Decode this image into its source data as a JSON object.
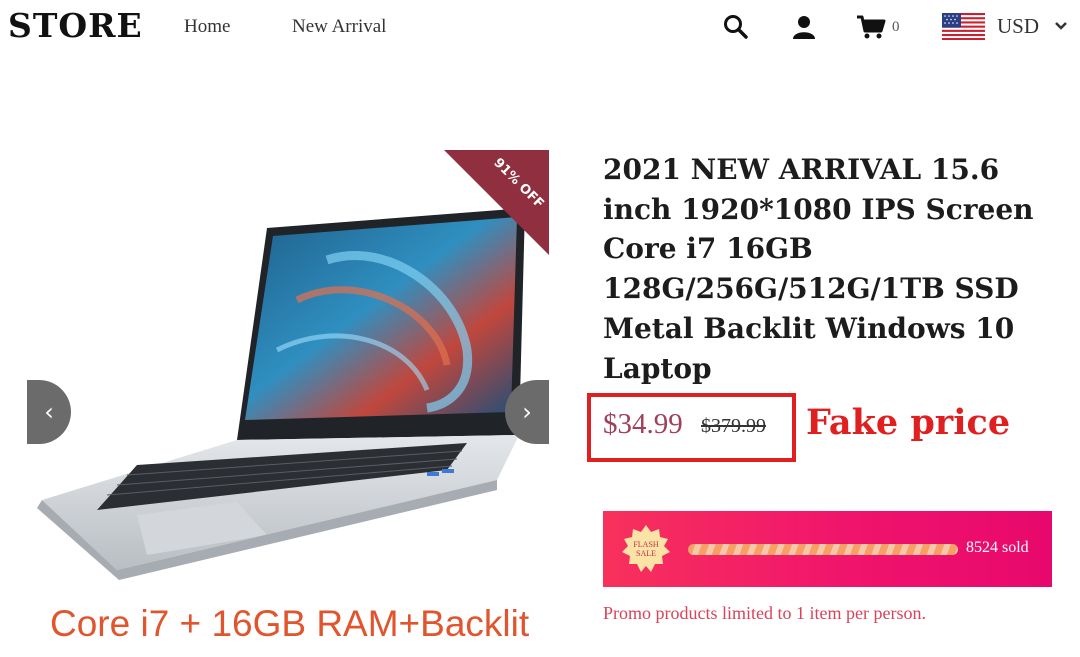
{
  "header": {
    "logo": "STORE",
    "nav": [
      "Home",
      "New Arrival"
    ],
    "cart_count": "0",
    "currency": "USD",
    "icons": [
      "search-icon",
      "user-icon",
      "cart-icon",
      "us-flag-icon",
      "chevron-down-icon"
    ]
  },
  "gallery": {
    "discount_ribbon": "91% OFF",
    "prev_symbol": "‹",
    "next_symbol": "›",
    "caption": "Core i7 + 16GB RAM+Backlit"
  },
  "product": {
    "title": "2021 NEW ARRIVAL 15.6 inch 1920*1080 IPS Screen Core i7 16GB 128G/256G/512G/1TB SSD Metal Backlit Windows 10 Laptop",
    "price": "$34.99",
    "compare_price": "$379.99",
    "annotation": "Fake price"
  },
  "flash_sale": {
    "badge_lines": [
      "FLASH",
      "SALE"
    ],
    "sold_text": "8524 sold",
    "promo_note": "Promo products limited to 1 item per person."
  },
  "colors": {
    "annotation_red": "#e02020",
    "price": "#a0405a",
    "flash_bg": "#f0146c",
    "ribbon": "#8f2f3f",
    "caption": "#e1552e"
  }
}
